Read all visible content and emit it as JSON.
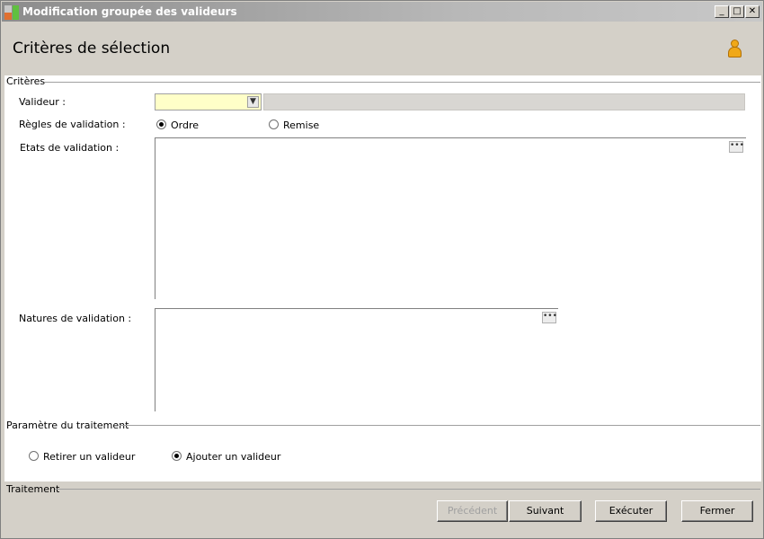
{
  "window": {
    "title": "Modification groupée des valideurs",
    "minimize": "_",
    "maximize": "□",
    "close": "✕"
  },
  "header": {
    "title": "Critères de sélection",
    "icon": "user-icon"
  },
  "criteres": {
    "group_label": "Critères",
    "valideur_label": "Valideur :",
    "valideur_value": "",
    "regles_label": "Règles de validation  :",
    "regles_options": [
      {
        "label": "Ordre",
        "checked": true
      },
      {
        "label": "Remise",
        "checked": false
      }
    ],
    "etats_label": "Etats de validation :",
    "natures_label": "Natures de validation :",
    "ellipsis": "•••"
  },
  "parametre": {
    "group_label": "Paramètre du traitement",
    "options": [
      {
        "label": "Retirer un valideur",
        "checked": false
      },
      {
        "label": "Ajouter un valideur",
        "checked": true
      }
    ]
  },
  "traitement": {
    "group_label": "Traitement",
    "buttons": {
      "previous": "Précédent",
      "next": "Suivant",
      "execute": "Exécuter",
      "close": "Fermer"
    },
    "previous_disabled": true
  }
}
